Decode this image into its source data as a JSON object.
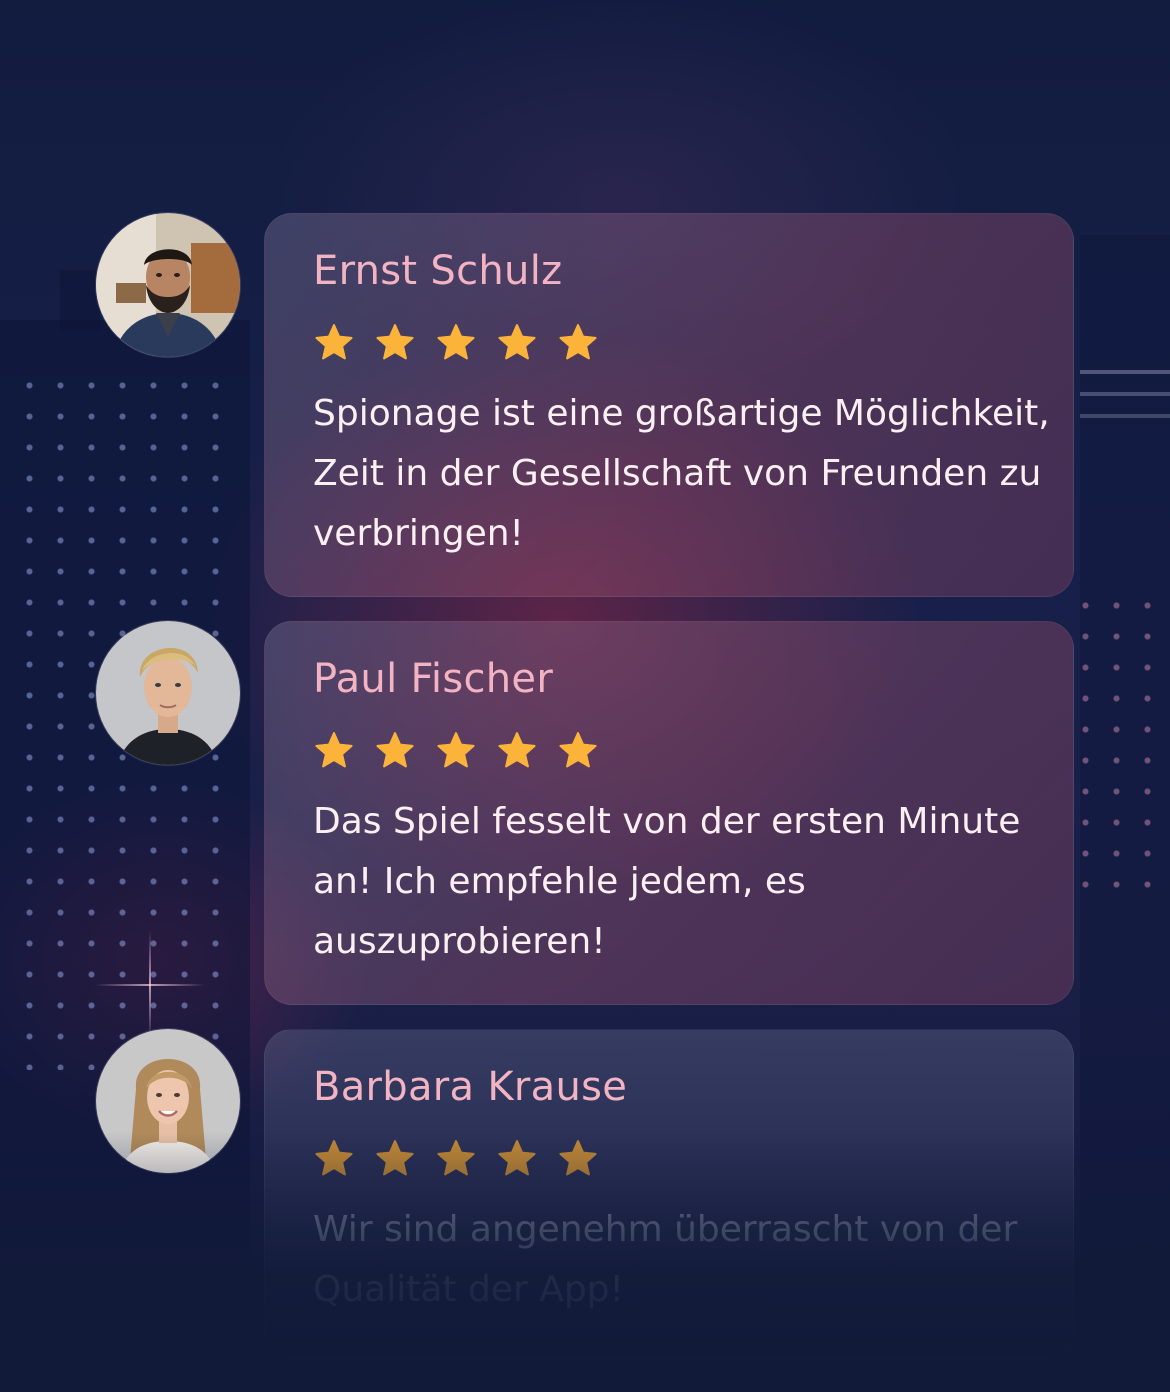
{
  "theme": {
    "name_color": "#f2b3c2",
    "star_color": "#fbb33a",
    "text_color": "#fbeff2",
    "background": "#121d40"
  },
  "reviews": [
    {
      "name": "Ernst Schulz",
      "rating": 5,
      "text": "Spionage ist eine großartige Möglichkeit, Zeit in der Gesellschaft von Freunden zu verbringen!",
      "avatar_icon": "avatar-man-bearded-icon"
    },
    {
      "name": "Paul Fischer",
      "rating": 5,
      "text": "Das Spiel fesselt von der ersten Minute an! Ich empfehle jedem, es auszuprobieren!",
      "avatar_icon": "avatar-man-blond-icon"
    },
    {
      "name": "Barbara Krause",
      "rating": 5,
      "text": "Wir sind angenehm überrascht von der Qualität der App!",
      "avatar_icon": "avatar-woman-blond-icon"
    }
  ]
}
